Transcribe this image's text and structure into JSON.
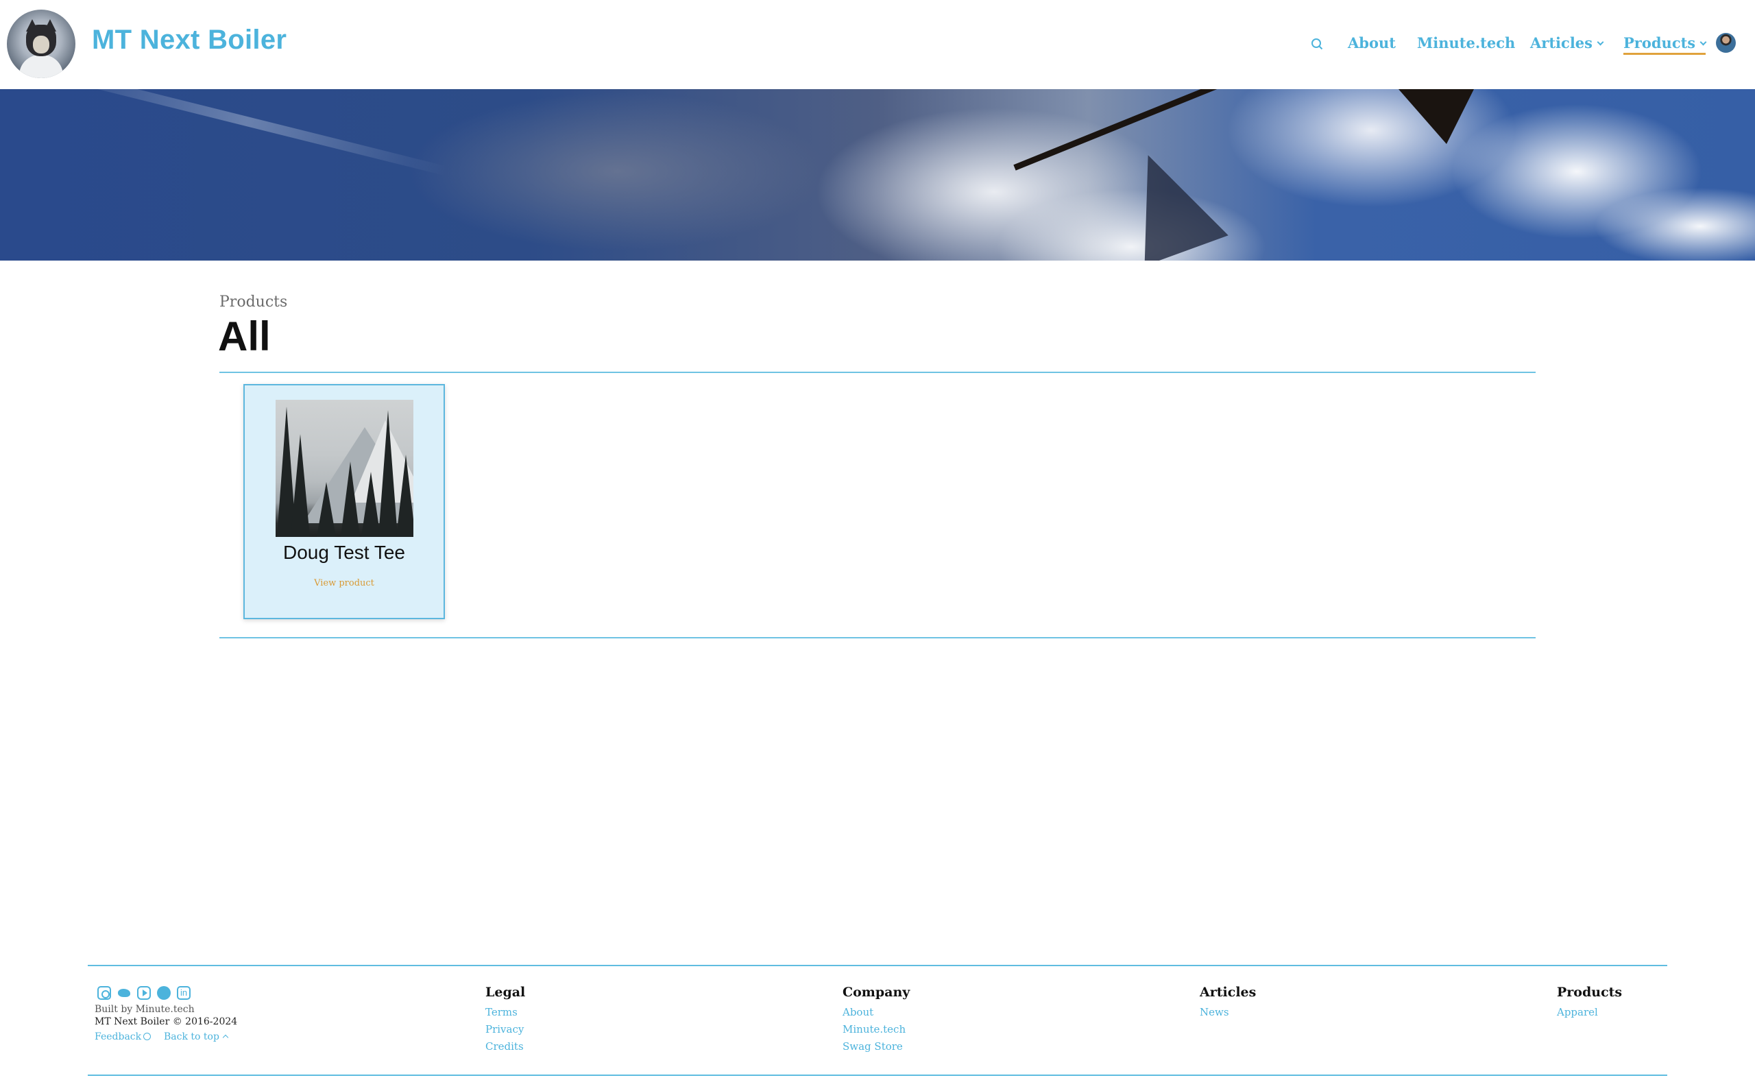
{
  "header": {
    "site_title": "MT Next Boiler",
    "search_icon": "search-icon",
    "nav": {
      "about": "About",
      "minute_tech": "Minute.tech",
      "articles": "Articles",
      "products": "Products"
    },
    "accent_color": "#4cb3dc",
    "active_underline_color": "#e0a23c"
  },
  "main": {
    "breadcrumb": "Products",
    "title": "All",
    "products": [
      {
        "name": "Doug Test Tee",
        "link_label": "View product"
      }
    ]
  },
  "footer": {
    "social_icons": [
      "instagram-icon",
      "twitter-icon",
      "youtube-icon",
      "github-icon",
      "linkedin-icon"
    ],
    "built_by": "Built by Minute.tech",
    "copyright": "MT Next Boiler © 2016-2024",
    "feedback": "Feedback",
    "back_to_top": "Back to top",
    "columns": {
      "legal": {
        "heading": "Legal",
        "links": [
          "Terms",
          "Privacy",
          "Credits"
        ]
      },
      "company": {
        "heading": "Company",
        "links": [
          "About",
          "Minute.tech",
          "Swag Store"
        ]
      },
      "articles": {
        "heading": "Articles",
        "links": [
          "News"
        ]
      },
      "products": {
        "heading": "Products",
        "links": [
          "Apparel"
        ]
      }
    }
  }
}
